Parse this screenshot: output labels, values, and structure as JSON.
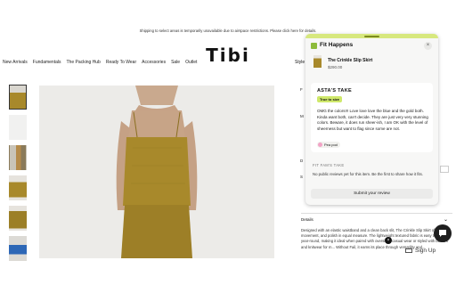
{
  "banner": {
    "text": "Shipping to select areas is temporarily unavailable due to airspace restrictions. Please click here for details."
  },
  "store": {
    "logo": "Tibi"
  },
  "nav": {
    "items": [
      "New Arrivals",
      "Fundamentals",
      "The Packing Hub",
      "Ready To Wear",
      "Accessories",
      "Sale",
      "Outlet"
    ],
    "right_partial": "Style"
  },
  "product_page": {
    "right_fragments": {
      "f1": "F",
      "m1": "M",
      "d1": "D",
      "s1": "S"
    },
    "details_label": "Details",
    "description": "Designed with an elastic waistband and a clean back slit, The Crinkle Slip Skirt offers ease, movement, and polish in equal measure. The lightweight textured fabric is easy to layer year-round, making it ideal when paired with oversized casual wear or styled with blazers and knitwear for m... Without Fail, it earns its place through versatility and..."
  },
  "fit_panel": {
    "title": "Fit Happens",
    "close_icon": "close-icon",
    "product": {
      "name": "The Crinkle Slip Skirt",
      "price": "$290.00"
    },
    "astas_take": {
      "heading": "ASTA'S TAKE",
      "badge": "True to size",
      "text": "OMG the colors!!! Love love love the blue and the gold both. Kinda want both, can't decide. They are just very very stunning colors. Beware, it does run sheer-ish, I am OK with the level of sheerness but want to flag since some are not.",
      "tag": "Pea pod"
    },
    "fan_take": {
      "heading": "FIT FAM'S TAKE",
      "text": "No public reviews yet for this item. Be the first to share how it fits."
    },
    "submit_label": "Submit your review"
  },
  "footer": {
    "signup_label": "Sign Up"
  },
  "colors": {
    "accent_green": "#d7e87e",
    "badge_green": "#cfe86a",
    "product_olive": "#a8892b"
  }
}
